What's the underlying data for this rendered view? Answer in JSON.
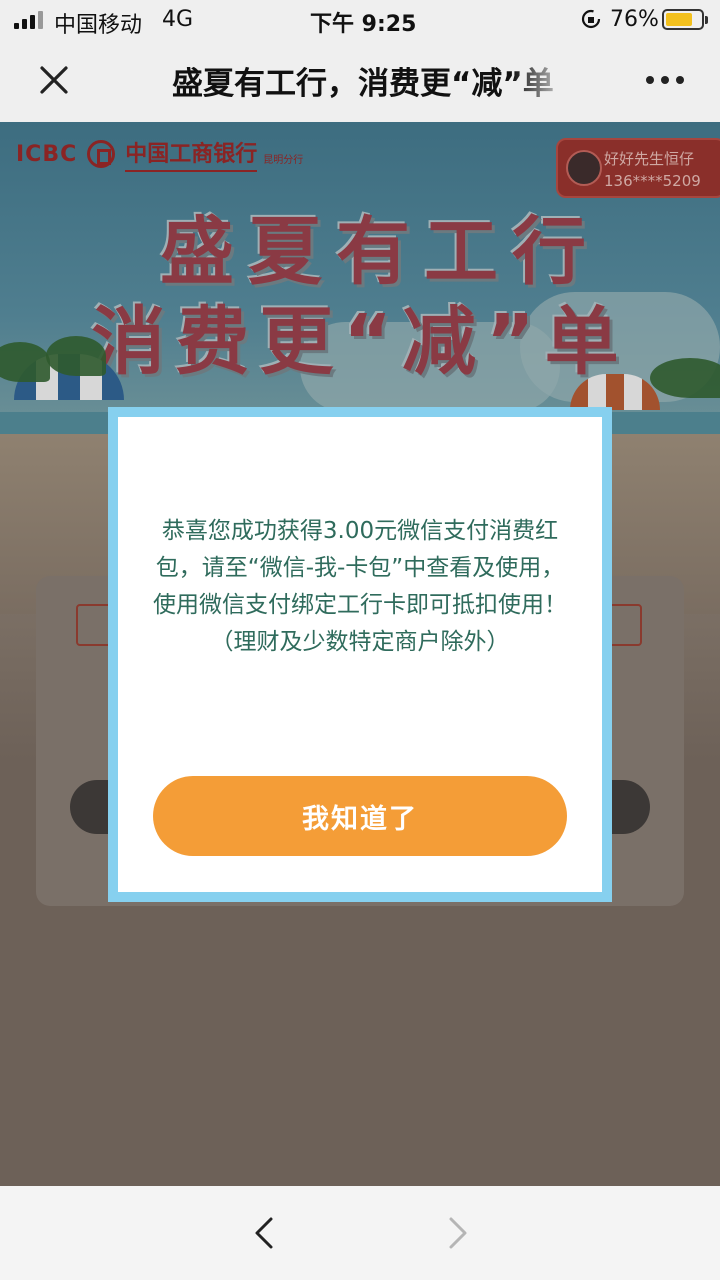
{
  "status_bar": {
    "carrier": "中国移动",
    "network": "4G",
    "time": "下午 9:25",
    "battery_percent": "76%",
    "battery_level": 0.76
  },
  "nav": {
    "title": "盛夏有工行，消费更“减”单",
    "close_icon": "close-icon",
    "more_icon": "more-dots-icon"
  },
  "page": {
    "bank_abbr": "ICBC",
    "bank_name": "中国工商银行",
    "branch": "昆明分行",
    "user_name": "好好先生恒仔",
    "user_phone": "136****5209",
    "headline_line1": "盛夏有工行",
    "headline_line2": "消费更“减”单"
  },
  "modal": {
    "message": "恭喜您成功获得3.00元微信支付消费红包，请至“微信-我-卡包”中查看及使用，使用微信支付绑定工行卡即可抵扣使用！",
    "note": "（理财及少数特定商户除外）",
    "button_label": "我知道了",
    "border_color": "#86d0ef",
    "button_color": "#f49d37",
    "text_color": "#2f6b5c"
  },
  "toolbar": {
    "back_icon": "chevron-left-icon",
    "forward_icon": "chevron-right-icon"
  }
}
